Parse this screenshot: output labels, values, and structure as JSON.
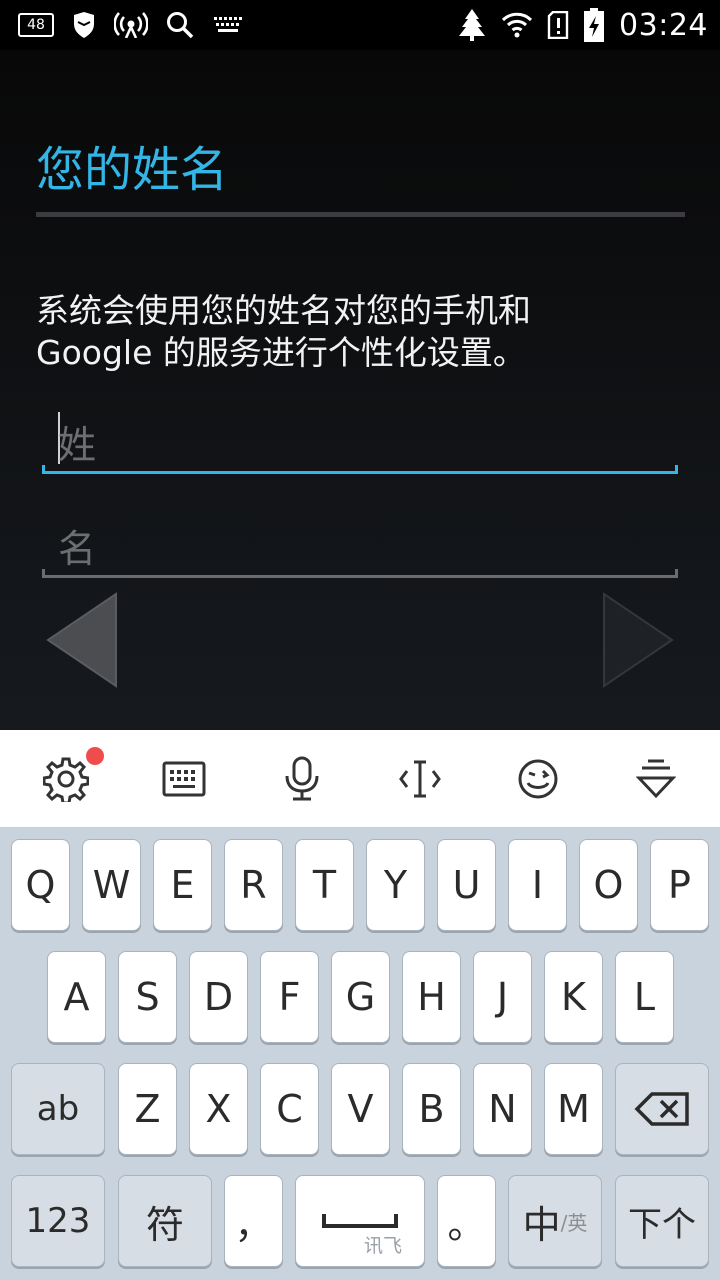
{
  "status_bar": {
    "badge": "48",
    "time": "03:24",
    "icons": [
      "notification-48-icon",
      "shield-icon",
      "hotspot-icon",
      "search-icon",
      "keyboard-icon",
      "tree-icon",
      "wifi-icon",
      "sim-alert-icon",
      "battery-charging-icon"
    ]
  },
  "page": {
    "title": "您的姓名",
    "description_line1": "系统会使用您的姓名对您的手机和",
    "description_line2": "Google 的服务进行个性化设置。",
    "last_name_placeholder": "姓",
    "first_name_placeholder": "名",
    "accent_color": "#33b5e5"
  },
  "toolbar": {
    "icons": [
      "settings-icon",
      "keyboard-switch-icon",
      "microphone-icon",
      "cursor-icon",
      "emoji-icon",
      "hide-keyboard-icon"
    ]
  },
  "keyboard": {
    "row1": [
      "Q",
      "W",
      "E",
      "R",
      "T",
      "Y",
      "U",
      "I",
      "O",
      "P"
    ],
    "row2": [
      "A",
      "S",
      "D",
      "F",
      "G",
      "H",
      "J",
      "K",
      "L"
    ],
    "row3": [
      "Z",
      "X",
      "C",
      "V",
      "B",
      "N",
      "M"
    ],
    "ab": "ab",
    "num": "123",
    "symbol": "符",
    "comma": "，",
    "space_hint": "讯飞",
    "period": "。",
    "lang_main": "中",
    "lang_sub": "/英",
    "next": "下个"
  }
}
